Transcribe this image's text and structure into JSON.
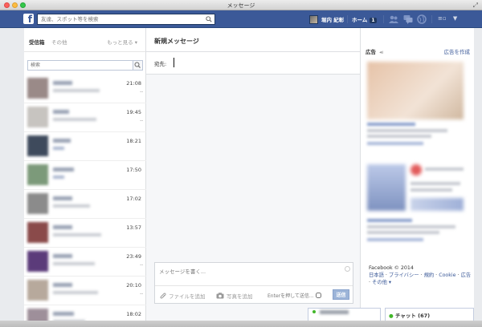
{
  "window": {
    "title": "メッセージ"
  },
  "topbar": {
    "search_placeholder": "友達、スポット等を検索",
    "user_name": "堀内 紀彰",
    "home_label": "ホーム",
    "home_count": "1",
    "brand_color": "#3b5998"
  },
  "inbox": {
    "tab_inbox": "受信箱",
    "tab_other": "その他",
    "see_more": "もっと見る ▾",
    "search_placeholder": "検索",
    "threads": [
      {
        "time": "21:08",
        "dot": ".."
      },
      {
        "time": "19:45",
        "dot": ".."
      },
      {
        "time": "18:21",
        "dot": ""
      },
      {
        "time": "17:50",
        "dot": ""
      },
      {
        "time": "17:02",
        "dot": ""
      },
      {
        "time": "13:57",
        "dot": ""
      },
      {
        "time": "23:49",
        "dot": ".."
      },
      {
        "time": "20:10",
        "dot": ".."
      },
      {
        "time": "18:02",
        "dot": ""
      }
    ]
  },
  "compose": {
    "title": "新規メッセージ",
    "to_label": "宛先:",
    "message_placeholder": "メッセージを書く...",
    "add_file": "ファイルを追加",
    "add_photo": "写真を追加",
    "enter_to_send": "Enterを押して送信...",
    "send_button": "送信"
  },
  "ads": {
    "label": "広告",
    "create_ad": "広告を作成"
  },
  "footer": {
    "copyright": "Facebook © 2014",
    "lang": "日本語",
    "privacy": "プライバシー",
    "terms": "規約",
    "cookie": "Cookie",
    "ads": "広告",
    "more": "その他 ▾"
  },
  "chat": {
    "label": "チャット (67)"
  }
}
